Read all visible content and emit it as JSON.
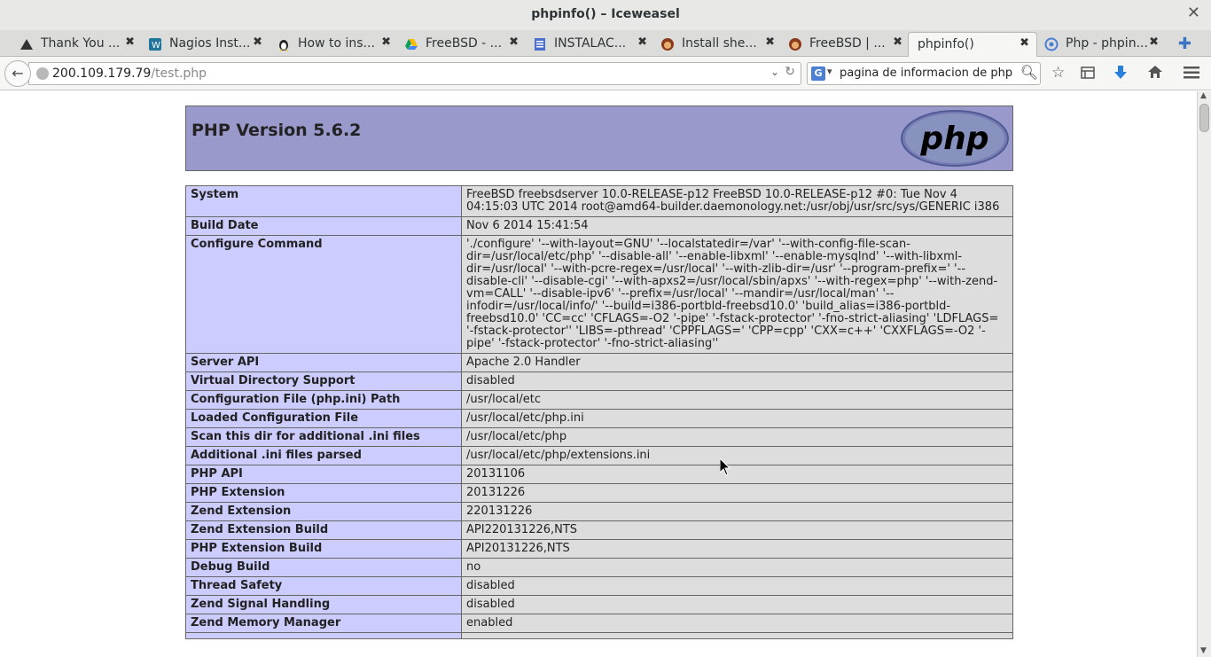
{
  "window": {
    "title": "phpinfo() – Iceweasel"
  },
  "tabs": [
    {
      "label": "Thank You ...",
      "icon": "shark-icon"
    },
    {
      "label": "Nagios Inst...",
      "icon": "wordpress-icon"
    },
    {
      "label": "How to ins...",
      "icon": "tux-icon"
    },
    {
      "label": "FreeBSD - ...",
      "icon": "google-drive-icon"
    },
    {
      "label": "INSTALAC...",
      "icon": "document-icon"
    },
    {
      "label": "Install she...",
      "icon": "beastie-icon"
    },
    {
      "label": "FreeBSD | ...",
      "icon": "beastie-icon"
    },
    {
      "label": "phpinfo()",
      "icon": ""
    },
    {
      "label": "Php - phpin...",
      "icon": "globe-icon"
    }
  ],
  "navbar": {
    "url_host": "200.109.179.79",
    "url_path": "/test.php",
    "search_value": "pagina de informacion de php",
    "search_engine": "G"
  },
  "php": {
    "version_title": "PHP Version 5.6.2",
    "logo_text": "php",
    "rows": [
      {
        "key": "System",
        "value": "FreeBSD freebsdserver 10.0-RELEASE-p12 FreeBSD 10.0-RELEASE-p12 #0: Tue Nov 4 04:15:03 UTC 2014 root@amd64-builder.daemonology.net:/usr/obj/usr/src/sys/GENERIC i386"
      },
      {
        "key": "Build Date",
        "value": "Nov 6 2014 15:41:54"
      },
      {
        "key": "Configure Command",
        "value": "'./configure' '--with-layout=GNU' '--localstatedir=/var' '--with-config-file-scan-dir=/usr/local/etc/php' '--disable-all' '--enable-libxml' '--enable-mysqlnd' '--with-libxml-dir=/usr/local' '--with-pcre-regex=/usr/local' '--with-zlib-dir=/usr' '--program-prefix=' '--disable-cli' '--disable-cgi' '--with-apxs2=/usr/local/sbin/apxs' '--with-regex=php' '--with-zend-vm=CALL' '--disable-ipv6' '--prefix=/usr/local' '--mandir=/usr/local/man' '--infodir=/usr/local/info/' '--build=i386-portbld-freebsd10.0' 'build_alias=i386-portbld-freebsd10.0' 'CC=cc' 'CFLAGS=-O2 '-pipe' '-fstack-protector' '-fno-strict-aliasing' 'LDFLAGS= '-fstack-protector'' 'LIBS=-pthread' 'CPPFLAGS=' 'CPP=cpp' 'CXX=c++' 'CXXFLAGS=-O2 '-pipe' '-fstack-protector' '-fno-strict-aliasing''"
      },
      {
        "key": "Server API",
        "value": "Apache 2.0 Handler"
      },
      {
        "key": "Virtual Directory Support",
        "value": "disabled"
      },
      {
        "key": "Configuration File (php.ini) Path",
        "value": "/usr/local/etc"
      },
      {
        "key": "Loaded Configuration File",
        "value": "/usr/local/etc/php.ini"
      },
      {
        "key": "Scan this dir for additional .ini files",
        "value": "/usr/local/etc/php"
      },
      {
        "key": "Additional .ini files parsed",
        "value": "/usr/local/etc/php/extensions.ini"
      },
      {
        "key": "PHP API",
        "value": "20131106"
      },
      {
        "key": "PHP Extension",
        "value": "20131226"
      },
      {
        "key": "Zend Extension",
        "value": "220131226"
      },
      {
        "key": "Zend Extension Build",
        "value": "API220131226,NTS"
      },
      {
        "key": "PHP Extension Build",
        "value": "API20131226,NTS"
      },
      {
        "key": "Debug Build",
        "value": "no"
      },
      {
        "key": "Thread Safety",
        "value": "disabled"
      },
      {
        "key": "Zend Signal Handling",
        "value": "disabled"
      },
      {
        "key": "Zend Memory Manager",
        "value": "enabled"
      },
      {
        "key": "",
        "value": ""
      }
    ]
  },
  "colors": {
    "header_bg": "#9999cc",
    "key_bg": "#ccccff",
    "value_bg": "#dddddd",
    "accent_blue": "#3a75c4"
  }
}
